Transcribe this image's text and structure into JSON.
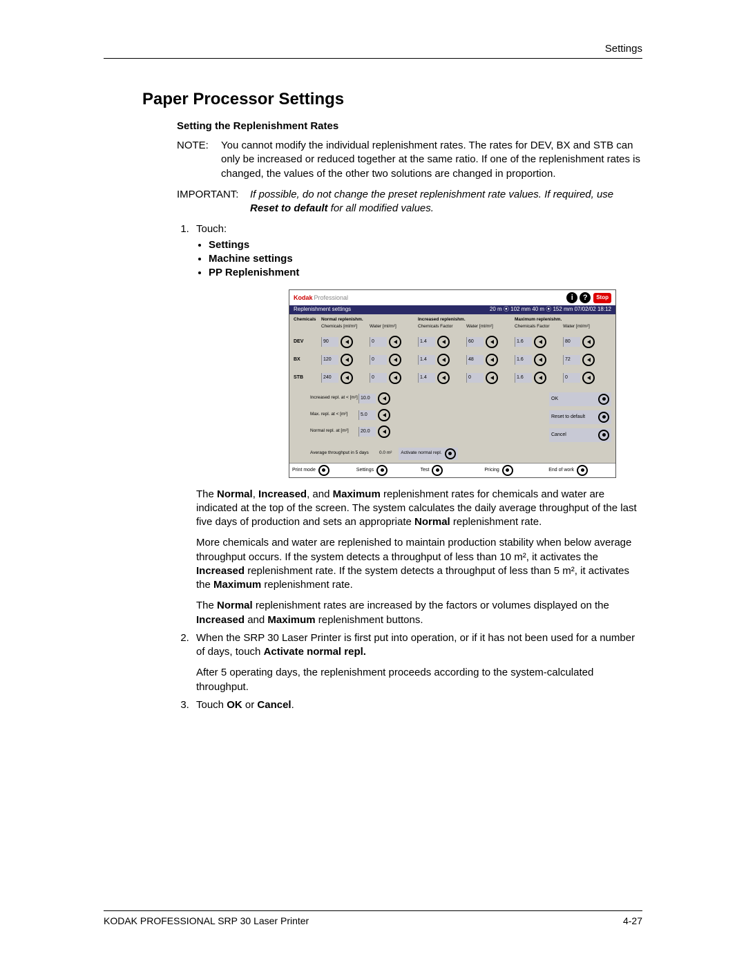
{
  "runningHead": "Settings",
  "h1": "Paper Processor Settings",
  "h2": "Setting the Replenishment Rates",
  "noteLabel": "NOTE:",
  "noteText": "You cannot modify the individual replenishment rates. The rates for DEV, BX and STB can only be increased or reduced together at the same ratio. If one of the replenishment rates is changed, the values of the other two solutions are changed in proportion.",
  "importantLabel": "IMPORTANT:",
  "importantPre": "If possible, do not change the preset replenishment rate values. If required, use ",
  "importantBold": "Reset to default",
  "importantPost": " for all modified values.",
  "step1Lead": "Touch:",
  "step1Bullets": [
    "Settings",
    "Machine settings",
    "PP Replenishment"
  ],
  "screenshot": {
    "brandK": "Kodak",
    "brandP": "Professional",
    "infoGlyph": "i",
    "helpGlyph": "?",
    "stop": "Stop",
    "title": "Replenishment settings",
    "status": "20 m ⦿ 102 mm   40 m ⦿ 152 mm  07/02/02     18:12",
    "groupHeaders": [
      "Chemicals",
      "Normal replenishm.",
      "Increased replenishm.",
      "Maximum replenishm."
    ],
    "subHeaders": [
      "Chemicals [ml/m²]",
      "Water [ml/m²]",
      "Chemicals Factor",
      "Water [ml/m²]",
      "Chemicals Factor",
      "Water [ml/m²]"
    ],
    "rows": [
      {
        "name": "DEV",
        "vals": [
          "90",
          "0",
          "1.4",
          "60",
          "1.6",
          "80"
        ]
      },
      {
        "name": "BX",
        "vals": [
          "120",
          "0",
          "1.4",
          "48",
          "1.6",
          "72"
        ]
      },
      {
        "name": "STB",
        "vals": [
          "240",
          "0",
          "1.4",
          "0",
          "1.6",
          "0"
        ]
      }
    ],
    "midRows": [
      {
        "label": "Increased repl. at < [m²]",
        "val": "10.0"
      },
      {
        "label": "Max. repl. at < [m²]",
        "val": "5.0"
      },
      {
        "label": "Normal repl. at [m²]",
        "val": "20.0"
      }
    ],
    "throughputLabel": "Average throughput in 5 days",
    "throughputVal": "0.0 m²",
    "activateLabel": "Activate normal repl.",
    "sideButtons": [
      "OK",
      "Reset to default",
      "Cancel"
    ],
    "bottom": [
      "Print mode",
      "Settings",
      "Test",
      "Pricing",
      "End of work"
    ]
  },
  "afterSS": {
    "p1a": "The ",
    "p1b": "Normal",
    "p1c": ", ",
    "p1d": "Increased",
    "p1e": ", and ",
    "p1f": "Maximum",
    "p1g": " replenishment rates for chemicals and water are indicated at the top of the screen. The system calculates the daily average throughput of the last five days of production and sets an appropriate ",
    "p1h": "Normal",
    "p1i": " replenishment rate.",
    "p2a": "More chemicals and water are replenished to maintain production stability when below average throughput occurs. If the system detects a throughput of less than 10 m², it activates the ",
    "p2b": "Increased",
    "p2c": " replenishment rate. If the system detects a throughput of less than 5 m², it activates the ",
    "p2d": "Maximum",
    "p2e": " replenishment rate.",
    "p3a": "The ",
    "p3b": "Normal",
    "p3c": " replenishment rates are increased by the factors or volumes displayed on the ",
    "p3d": "Increased",
    "p3e": " and ",
    "p3f": "Maximum",
    "p3g": " replenishment buttons."
  },
  "step2a": "When the SRP 30 Laser Printer is first put into operation, or if it has not been used for a number of days, touch ",
  "step2b": "Activate normal repl.",
  "step2after": "After 5 operating days, the replenishment proceeds according to the system-calculated throughput.",
  "step3a": "Touch ",
  "step3b": "OK",
  "step3c": " or ",
  "step3d": "Cancel",
  "step3e": ".",
  "footerLeft": "KODAK PROFESSIONAL SRP 30 Laser Printer",
  "footerRight": "4-27"
}
